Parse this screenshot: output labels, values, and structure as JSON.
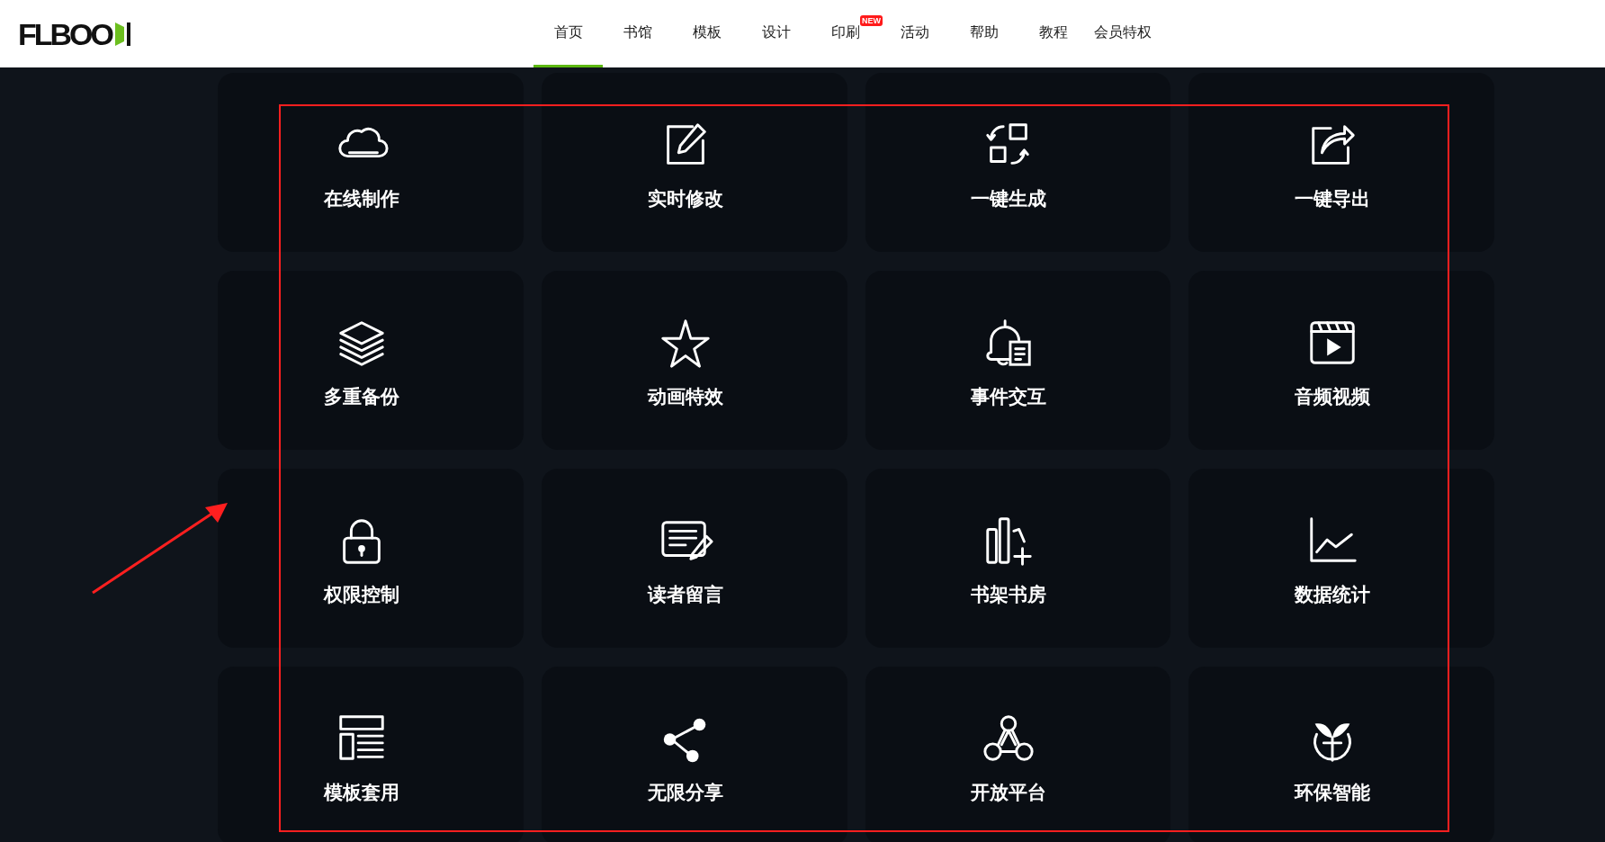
{
  "header": {
    "logo": "FLBOO",
    "nav": [
      {
        "label": "首页",
        "selected": true
      },
      {
        "label": "书馆",
        "selected": false
      },
      {
        "label": "模板",
        "selected": false
      },
      {
        "label": "设计",
        "selected": false
      },
      {
        "label": "印刷",
        "selected": false,
        "badge": "NEW"
      },
      {
        "label": "活动",
        "selected": false
      },
      {
        "label": "帮助",
        "selected": false
      },
      {
        "label": "教程",
        "selected": false
      },
      {
        "label": "会员特权",
        "selected": false
      }
    ]
  },
  "features": [
    {
      "label": "在线制作"
    },
    {
      "label": "实时修改"
    },
    {
      "label": "一键生成"
    },
    {
      "label": "一键导出"
    },
    {
      "label": "多重备份"
    },
    {
      "label": "动画特效"
    },
    {
      "label": "事件交互"
    },
    {
      "label": "音频视频"
    },
    {
      "label": "权限控制"
    },
    {
      "label": "读者留言"
    },
    {
      "label": "书架书房"
    },
    {
      "label": "数据统计"
    },
    {
      "label": "模板套用"
    },
    {
      "label": "无限分享"
    },
    {
      "label": "开放平台"
    },
    {
      "label": "环保智能"
    }
  ]
}
